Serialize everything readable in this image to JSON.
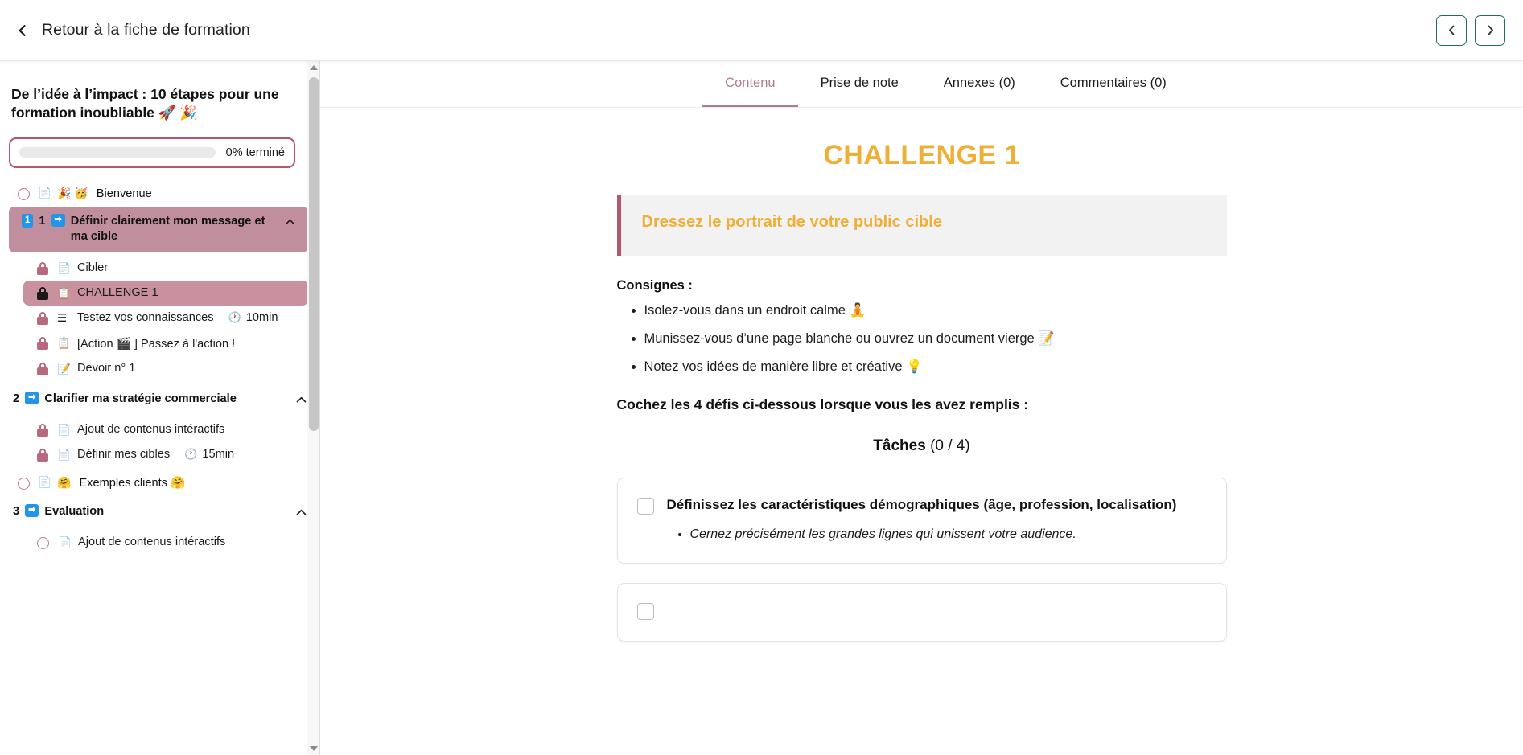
{
  "topbar": {
    "back_label": "Retour à la fiche de formation",
    "prev_label": "‹",
    "next_label": "›"
  },
  "sidebar": {
    "course_title": "De l’idée à l’impact : 10 étapes pour une formation inoubliable 🚀 🎉",
    "progress": {
      "percent": 0,
      "label": "0% terminé"
    },
    "items": [
      {
        "type": "lesson",
        "state": "circle",
        "doc_icon": "📄",
        "emoji": "🎉 🥳",
        "label": "Bienvenue"
      },
      {
        "type": "section",
        "active": true,
        "num_badge": "1",
        "num_text": "1",
        "arrow_badge": "➡",
        "label": "Définir clairement mon message et ma cible",
        "chevron": "chevron-up",
        "children": [
          {
            "lock": "pink",
            "doc_icon": "📄",
            "label": "Cibler",
            "duration": ""
          },
          {
            "lock": "dark",
            "doc_icon": "📋",
            "label": "CHALLENGE 1",
            "duration": "",
            "selected": true
          },
          {
            "lock": "pink",
            "doc_icon": "☰",
            "label": "Testez vos connaissances",
            "duration": "10min"
          },
          {
            "lock": "pink",
            "doc_icon": "📋",
            "label": "[Action 🎬 ] Passez à l'action !",
            "duration": ""
          },
          {
            "lock": "pink",
            "doc_icon": "📝",
            "label": "Devoir n° 1",
            "duration": ""
          }
        ]
      },
      {
        "type": "section",
        "active": false,
        "num_badge": "",
        "num_text": "2",
        "arrow_badge": "➡",
        "label": "Clarifier ma stratégie commerciale",
        "chevron": "chevron-up",
        "children": [
          {
            "lock": "pink",
            "doc_icon": "📄",
            "label": "Ajout de contenus intéractifs",
            "duration": ""
          },
          {
            "lock": "pink",
            "doc_icon": "📄",
            "label": "Définir mes cibles",
            "duration": "15min"
          }
        ]
      },
      {
        "type": "lesson",
        "state": "circle",
        "doc_icon": "📄",
        "emoji": "🤗",
        "label": "Exemples clients 🤗"
      },
      {
        "type": "section",
        "active": false,
        "num_badge": "",
        "num_text": "3",
        "arrow_badge": "➡",
        "label": "Evaluation",
        "chevron": "chevron-up",
        "children": [
          {
            "lock": "none",
            "doc_icon": "📄",
            "label": "Ajout de contenus intéractifs",
            "duration": ""
          }
        ]
      }
    ]
  },
  "main": {
    "tabs": [
      {
        "label": "Contenu",
        "active": true
      },
      {
        "label": "Prise de note",
        "active": false
      },
      {
        "label": "Annexes (0)",
        "active": false
      },
      {
        "label": "Commentaires (0)",
        "active": false
      }
    ],
    "challenge_title": "CHALLENGE 1",
    "callout_text": "Dressez le portrait de votre public cible",
    "consignes_heading": "Consignes :",
    "consignes": [
      "Isolez-vous dans un endroit calme 🧘",
      "Munissez-vous d’une page blanche ou ouvrez un document vierge 📝",
      "Notez vos idées de manière libre et créative 💡"
    ],
    "cochez_heading": "Cochez les 4 défis ci-dessous lorsque vous les avez remplis :",
    "taches_label": "Tâches",
    "taches_count": "(0 / 4)",
    "tasks": [
      {
        "checked": false,
        "title": "Définissez les caractéristiques démographiques (âge, profession, localisation)",
        "subitems": [
          "Cernez précisément les grandes lignes qui unissent votre audience."
        ]
      },
      {
        "checked": false,
        "title": "",
        "subitems": []
      }
    ]
  },
  "colors": {
    "accent_pink": "#b4566d",
    "accent_gold": "#efaf36",
    "badge_blue": "#2196e8",
    "nav_border_teal": "#1f6b63"
  }
}
